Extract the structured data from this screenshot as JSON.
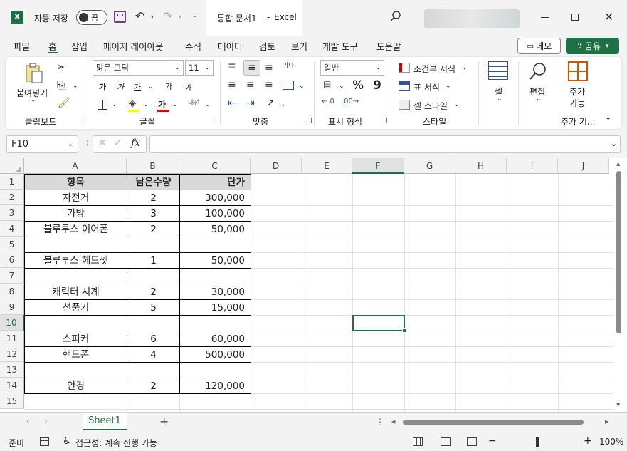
{
  "titlebar": {
    "autosave_label": "자동 저장",
    "autosave_state": "끔",
    "doc_title": "통합 문서1",
    "separator": "-",
    "app_name": "Excel"
  },
  "menu": [
    "파일",
    "홈",
    "삽입",
    "페이지 레이아웃",
    "수식",
    "데이터",
    "검토",
    "보기",
    "개발 도구",
    "도움말"
  ],
  "menu_active": "홈",
  "memo_label": "메모",
  "share_label": "공유",
  "ribbon": {
    "clipboard": {
      "paste": "붙여넣기",
      "label": "클립보드"
    },
    "font": {
      "name": "맑은 고딕",
      "size": "11",
      "label": "글꼴",
      "b": "가",
      "i": "가",
      "u": "가",
      "grow": "가",
      "shrink": "가",
      "color_a": "가",
      "phonetic": "내선"
    },
    "align": {
      "label": "맞춤",
      "wrap": "가나"
    },
    "number": {
      "format": "일반",
      "label": "표시 형식",
      "pct": "%",
      "comma": "9"
    },
    "style": {
      "cond": "조건부 서식",
      "table": "표 서식",
      "cell": "셀 스타일",
      "label": "스타일"
    },
    "cells": {
      "label": "셀"
    },
    "edit": {
      "label": "편집"
    },
    "addin": {
      "label_top": "추가",
      "label_bottom": "기능",
      "group": "추가 기..."
    }
  },
  "formula": {
    "namebox": "F10",
    "fx": "fx",
    "value": ""
  },
  "columns": [
    "A",
    "B",
    "C",
    "D",
    "E",
    "F",
    "G",
    "H",
    "I",
    "J"
  ],
  "rows": [
    "1",
    "2",
    "3",
    "4",
    "5",
    "6",
    "7",
    "8",
    "9",
    "10",
    "11",
    "12",
    "13",
    "14",
    "15"
  ],
  "active_cell": "F10",
  "table": {
    "headers": [
      "항목",
      "남은수량",
      "단가"
    ],
    "data": [
      [
        "자전거",
        "2",
        "300,000"
      ],
      [
        "가방",
        "3",
        "100,000"
      ],
      [
        "블루투스 이어폰",
        "2",
        "50,000"
      ],
      [
        "",
        "",
        ""
      ],
      [
        "블루투스 헤드셋",
        "1",
        "50,000"
      ],
      [
        "",
        "",
        ""
      ],
      [
        "캐릭터 시계",
        "2",
        "30,000"
      ],
      [
        "선풍기",
        "5",
        "15,000"
      ],
      [
        "",
        "",
        ""
      ],
      [
        "스피커",
        "6",
        "60,000"
      ],
      [
        "핸드폰",
        "4",
        "500,000"
      ],
      [
        "",
        "",
        ""
      ],
      [
        "안경",
        "2",
        "120,000"
      ]
    ]
  },
  "sheet_tab": "Sheet1",
  "add_sheet": "+",
  "status": {
    "ready": "준비",
    "accessibility": "접근성: 계속 진행 가능",
    "zoom": "100%"
  },
  "colors": {
    "accent": "#1e7145",
    "header_fill": "#d9d9d9"
  }
}
